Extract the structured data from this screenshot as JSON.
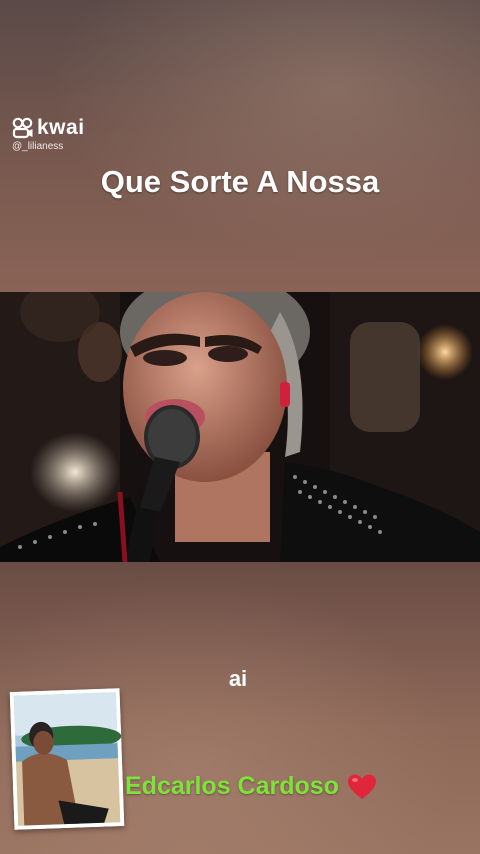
{
  "watermark": {
    "logo_text": "kwai",
    "handle": "@_lilianess",
    "icon": "kwai-logo-icon"
  },
  "song": {
    "title": "Que Sorte A Nossa"
  },
  "lyrics": {
    "current_line": "ai"
  },
  "credit": {
    "artist": "Edcarlos Cardoso",
    "icon": "heart-icon",
    "artist_color": "#7fe23a",
    "heart_color": "#e0263a"
  }
}
